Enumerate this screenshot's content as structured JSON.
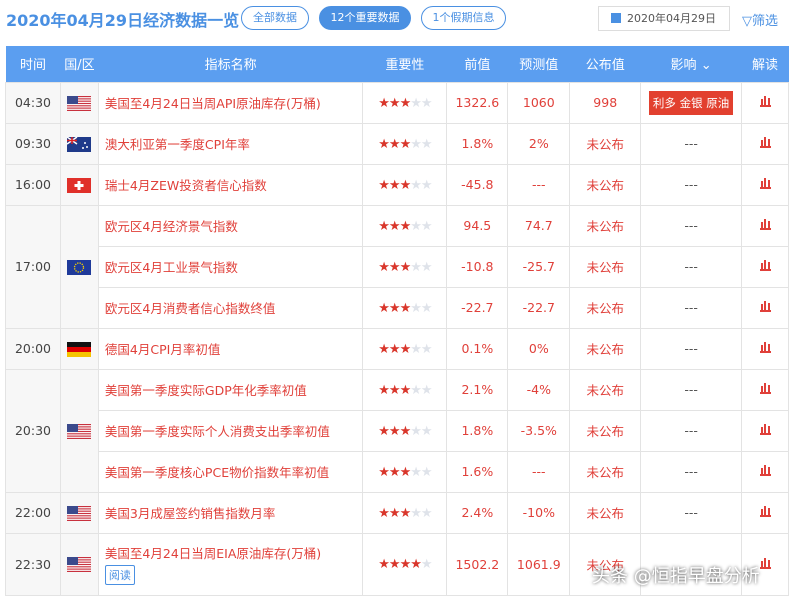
{
  "header": {
    "title": "2020年04月29日经济数据一览",
    "tabs": [
      "全部数据",
      "12个重要数据",
      "1个假期信息"
    ],
    "date": "2020年04月29日",
    "filter": "筛选"
  },
  "columns": [
    "时间",
    "国/区",
    "指标名称",
    "重要性",
    "前值",
    "预测值",
    "公布值",
    "影响",
    "解读"
  ],
  "rows": [
    {
      "time": "04:30",
      "country": "us",
      "name": "美国至4月24日当周API原油库存(万桶)",
      "stars": 3,
      "prev": "1322.6",
      "forecast": "1060",
      "actual": "998",
      "impact": "利多 金银 原油"
    },
    {
      "time": "09:30",
      "country": "au",
      "name": "澳大利亚第一季度CPI年率",
      "stars": 3,
      "prev": "1.8%",
      "forecast": "2%",
      "actual": "未公布",
      "impact": "---"
    },
    {
      "time": "16:00",
      "country": "ch",
      "name": "瑞士4月ZEW投资者信心指数",
      "stars": 3,
      "prev": "-45.8",
      "forecast": "---",
      "actual": "未公布",
      "impact": "---"
    },
    {
      "time": "17:00",
      "country": "eu",
      "name": "欧元区4月经济景气指数",
      "stars": 3,
      "prev": "94.5",
      "forecast": "74.7",
      "actual": "未公布",
      "impact": "---"
    },
    {
      "time": "",
      "country": "",
      "name": "欧元区4月工业景气指数",
      "stars": 3,
      "prev": "-10.8",
      "forecast": "-25.7",
      "actual": "未公布",
      "impact": "---"
    },
    {
      "time": "",
      "country": "",
      "name": "欧元区4月消费者信心指数终值",
      "stars": 3,
      "prev": "-22.7",
      "forecast": "-22.7",
      "actual": "未公布",
      "impact": "---"
    },
    {
      "time": "20:00",
      "country": "de",
      "name": "德国4月CPI月率初值",
      "stars": 3,
      "prev": "0.1%",
      "forecast": "0%",
      "actual": "未公布",
      "impact": "---"
    },
    {
      "time": "20:30",
      "country": "us",
      "name": "美国第一季度实际GDP年化季率初值",
      "stars": 3,
      "prev": "2.1%",
      "forecast": "-4%",
      "actual": "未公布",
      "impact": "---"
    },
    {
      "time": "",
      "country": "",
      "name": "美国第一季度实际个人消费支出季率初值",
      "stars": 3,
      "prev": "1.8%",
      "forecast": "-3.5%",
      "actual": "未公布",
      "impact": "---"
    },
    {
      "time": "",
      "country": "",
      "name": "美国第一季度核心PCE物价指数年率初值",
      "stars": 3,
      "prev": "1.6%",
      "forecast": "---",
      "actual": "未公布",
      "impact": "---"
    },
    {
      "time": "22:00",
      "country": "us",
      "name": "美国3月成屋签约销售指数月率",
      "stars": 3,
      "prev": "2.4%",
      "forecast": "-10%",
      "actual": "未公布",
      "impact": "---"
    },
    {
      "time": "22:30",
      "country": "us",
      "name": "美国至4月24日当周EIA原油库存(万桶)",
      "stars": 4,
      "prev": "1502.2",
      "forecast": "1061.9",
      "actual": "未公布",
      "impact": "",
      "read": "阅读"
    }
  ],
  "watermark": "头条 @恒指早盘分析"
}
